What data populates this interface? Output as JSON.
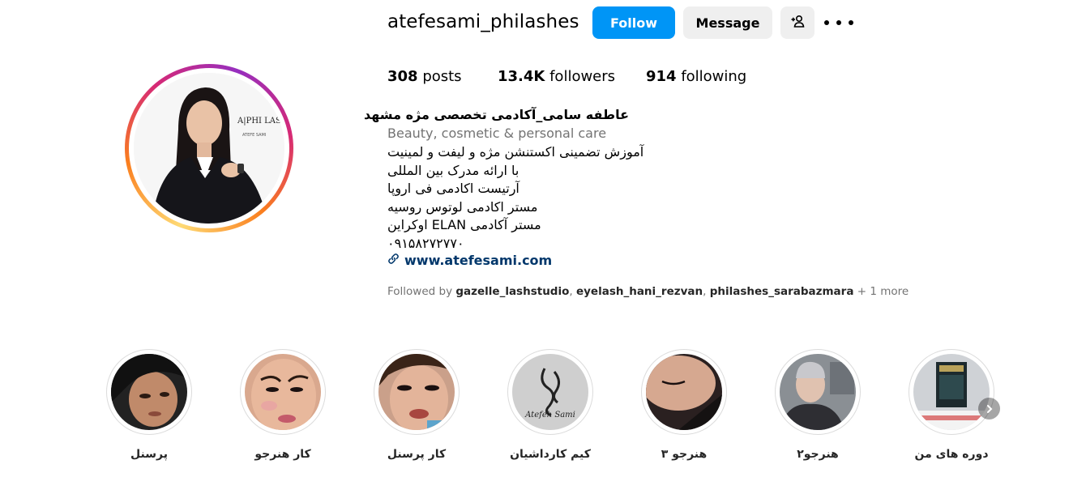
{
  "profile": {
    "username": "atefesami_philashes",
    "follow_label": "Follow",
    "message_label": "Message",
    "add_user_icon": "add-user-icon",
    "more_icon": "more-options-icon",
    "avatar_logo_text": "A|PHI LASHE",
    "avatar_logo_subtext": "ATEFE SAMI"
  },
  "stats": {
    "posts_count": "308",
    "posts_label": "posts",
    "followers_count": "13.4K",
    "followers_label": "followers",
    "following_count": "914",
    "following_label": "following"
  },
  "bio": {
    "name": "عاطفه سامی_آکادمی تخصصی مژه مشهد",
    "category": "Beauty, cosmetic & personal care",
    "lines": [
      "آموزش تضمینی اکستنشن مژه و لیفت و لمینیت",
      "با ارائه مدرک بین المللی",
      "آرتیست اکادمی فی اروپا",
      "مستر اکادمی لوتوس روسیه",
      "مستر آکادمی ELAN اوکراین",
      "۰۹۱۵۸۲۷۲۷۷۰"
    ],
    "link": "www.atefesami.com",
    "link_icon": "link-icon"
  },
  "followed_by": {
    "prefix": "Followed by",
    "users": [
      "gazelle_lashstudio",
      "eyelash_hani_rezvan",
      "philashes_sarabazmara"
    ],
    "more": "+ 1 more"
  },
  "highlights": [
    {
      "label": "پرسنل"
    },
    {
      "label": "کار هنرجو"
    },
    {
      "label": "کار پرسنل"
    },
    {
      "label": "کیم کارداشیان",
      "logo_text": "Atefeh Sami"
    },
    {
      "label": "هنرجو ۳"
    },
    {
      "label": "هنرجو۲"
    },
    {
      "label": "دوره های من"
    }
  ],
  "highlights_next_icon": "chevron-right-icon",
  "colors": {
    "follow_blue": "#0095f6",
    "link_color": "#00376b",
    "secondary_text": "#737373",
    "button_gray": "#efefef"
  }
}
